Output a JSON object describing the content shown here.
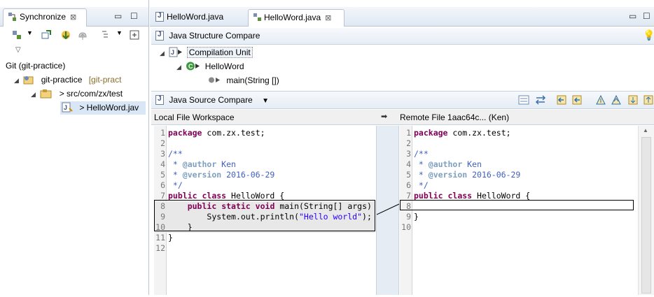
{
  "left_view": {
    "tab_title": "Synchronize",
    "close_glyph": "⊠",
    "minimize_glyph": "▭",
    "maximize_glyph": "☐",
    "tree": [
      {
        "label": "Git (git-practice)",
        "indent": 0
      },
      {
        "label": "git-practice",
        "suffix": "[git-pract",
        "indent": 1
      },
      {
        "label": "> src/com/zx/test",
        "indent": 2
      },
      {
        "label": "> HelloWord.jav",
        "indent": 3
      }
    ]
  },
  "editor_tabs": [
    {
      "label": "HelloWord.java",
      "active": false
    },
    {
      "label": "HelloWord.java",
      "active": true
    }
  ],
  "structure_compare": {
    "title": "Java Structure Compare",
    "nodes": [
      {
        "label": "Compilation Unit"
      },
      {
        "label": "HelloWord"
      },
      {
        "label": "main(String [])"
      }
    ]
  },
  "source_compare": {
    "title": "Java Source Compare",
    "dropdown_glyph": "▼"
  },
  "local_header": "Local File Workspace",
  "remote_header": "Remote File 1aac64c... (Ken)",
  "center_arrow": "➡",
  "left_code": [
    {
      "n": "1",
      "t": "package com.zx.test;"
    },
    {
      "n": "2",
      "t": ""
    },
    {
      "n": "3",
      "t": "/**"
    },
    {
      "n": "4",
      "t": " * @author Ken"
    },
    {
      "n": "5",
      "t": " * @version 2016-06-29"
    },
    {
      "n": "6",
      "t": " */"
    },
    {
      "n": "7",
      "t": "public class HelloWord {"
    },
    {
      "n": "8",
      "t": "    public static void main(String[] args)"
    },
    {
      "n": "9",
      "t": "        System.out.println(\"Hello world\");"
    },
    {
      "n": "10",
      "t": "    }"
    },
    {
      "n": "11",
      "t": "}"
    },
    {
      "n": "12",
      "t": ""
    }
  ],
  "right_code": [
    {
      "n": "1",
      "t": "package com.zx.test;"
    },
    {
      "n": "2",
      "t": ""
    },
    {
      "n": "3",
      "t": "/**"
    },
    {
      "n": "4",
      "t": " * @author Ken"
    },
    {
      "n": "5",
      "t": " * @version 2016-06-29"
    },
    {
      "n": "6",
      "t": " */"
    },
    {
      "n": "7",
      "t": "public class HelloWord {"
    },
    {
      "n": "8",
      "t": ""
    },
    {
      "n": "9",
      "t": "}"
    },
    {
      "n": "10",
      "t": ""
    }
  ],
  "colors": {
    "keyword": "#7f0055",
    "comment": "#3f5fbf",
    "string": "#2a00ff",
    "chrome_border": "#b9c5d6"
  }
}
